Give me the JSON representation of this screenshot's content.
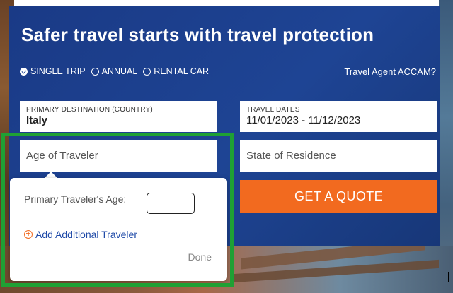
{
  "headline": "Safer travel starts with travel protection",
  "trip_options": [
    {
      "label": "SINGLE TRIP",
      "checked": true
    },
    {
      "label": "ANNUAL",
      "checked": false
    },
    {
      "label": "RENTAL CAR",
      "checked": false
    }
  ],
  "agent_link": "Travel Agent ACCAM?",
  "destination": {
    "label": "PRIMARY DESTINATION (COUNTRY)",
    "value": "Italy"
  },
  "travel_dates": {
    "label": "TRAVEL DATES",
    "value": "11/01/2023 - 11/12/2023"
  },
  "age_field": {
    "placeholder": "Age of Traveler"
  },
  "state_field": {
    "placeholder": "State of Residence"
  },
  "quote_button": "GET A QUOTE",
  "popover": {
    "age_label": "Primary Traveler's Age:",
    "age_value": "",
    "add_traveler": "Add Additional Traveler",
    "done": "Done"
  },
  "colors": {
    "panel": "#1e4494",
    "accent": "#f26a1f",
    "highlight": "#1fa034",
    "link": "#1f4aa8"
  },
  "icons": {
    "radio_checked": "check-circle-icon",
    "radio_unchecked": "circle-icon",
    "add": "plus-circle-icon"
  }
}
